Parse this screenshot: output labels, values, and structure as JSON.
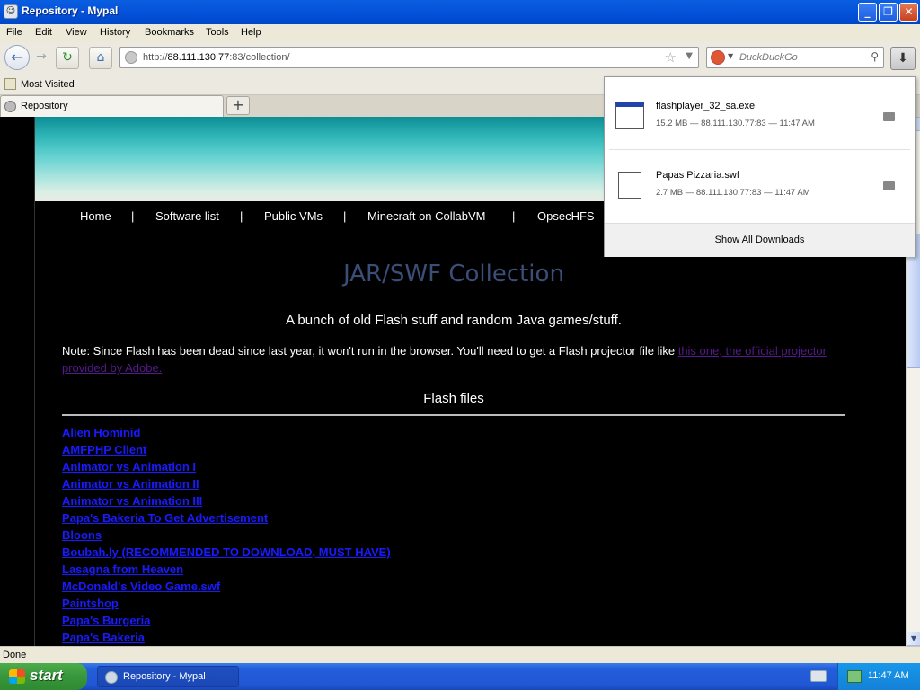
{
  "window": {
    "title": "Repository - Mypal",
    "minimize": "_",
    "maximize": "❐",
    "close": "✕"
  },
  "menu": [
    "File",
    "Edit",
    "View",
    "History",
    "Bookmarks",
    "Tools",
    "Help"
  ],
  "nav": {
    "url_prefix": "http://",
    "url_host": "88.111.130.77",
    "url_rest": ":83/collection/",
    "search_placeholder": "DuckDuckGo"
  },
  "bookmarks": {
    "most_visited": "Most Visited"
  },
  "tabs": [
    {
      "label": "Repository"
    }
  ],
  "site": {
    "nav_items": [
      "Home",
      "|",
      "Software list",
      "|",
      "Public VMs",
      "|",
      "Minecraft on CollabVM",
      "|",
      "OpsecHFS"
    ],
    "title": "JAR/SWF Collection",
    "subtitle": "A bunch of old Flash stuff and random Java games/stuff.",
    "note_text": "Note: Since Flash has been dead since last year, it won't run in the browser. You'll need to get a Flash projector file like ",
    "note_link": "this one, the official projector provided by Adobe.",
    "flash_header": "Flash files",
    "flash_links": [
      "Alien Hominid",
      "AMFPHP Client",
      "Animator vs Animation I",
      "Animator vs Animation II",
      "Animator vs Animation III",
      "Papa's Bakeria To Get Advertisement",
      "Bloons",
      "Boubah.ly (RECOMMENDED TO DOWNLOAD, MUST HAVE)",
      "Lasagna from Heaven",
      "McDonald's Video Game.swf",
      "Paintshop",
      "Papa's Burgeria",
      "Papa's Bakeria"
    ]
  },
  "downloads": {
    "items": [
      {
        "name": "flashplayer_32_sa.exe",
        "meta": "15.2 MB — 88.111.130.77:83 — 11:47 AM"
      },
      {
        "name": "Papas Pizzaria.swf",
        "meta": "2.7 MB — 88.111.130.77:83 — 11:47 AM"
      }
    ],
    "show_all": "Show All Downloads"
  },
  "status": {
    "text": "Done"
  },
  "taskbar": {
    "start": "start",
    "item": "Repository - Mypal",
    "clock": "11:47 AM"
  }
}
